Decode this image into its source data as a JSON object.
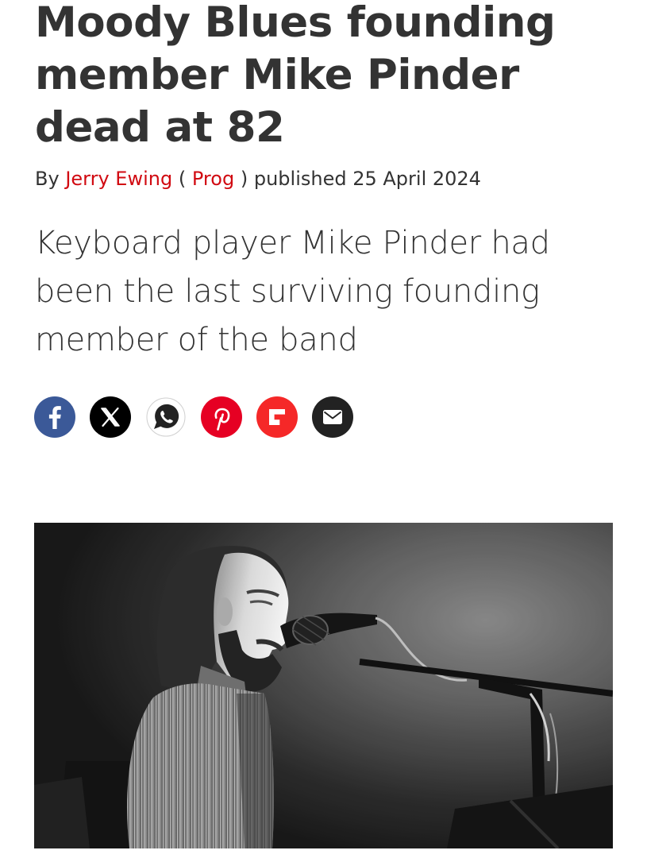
{
  "article": {
    "headline": "Moody Blues founding member Mike Pinder dead at 82",
    "byline": {
      "by": "By",
      "author": "Jerry Ewing",
      "open_paren": "(",
      "publication": "Prog",
      "close_paren": ")",
      "published_label": "published",
      "date": "25 April 2024"
    },
    "strapline": "Keyboard player Mike Pinder had been the last surviving founding member of the band"
  },
  "share_buttons": [
    {
      "icon": "facebook-icon",
      "color": "#3b5998"
    },
    {
      "icon": "x-icon",
      "color": "#000000"
    },
    {
      "icon": "whatsapp-icon",
      "color": "#ffffff"
    },
    {
      "icon": "pinterest-icon",
      "color": "#e60023"
    },
    {
      "icon": "flipboard-icon",
      "color": "#f52828"
    },
    {
      "icon": "email-icon",
      "color": "#222222"
    }
  ],
  "colors": {
    "link": "#d10a11",
    "text": "#333333"
  }
}
